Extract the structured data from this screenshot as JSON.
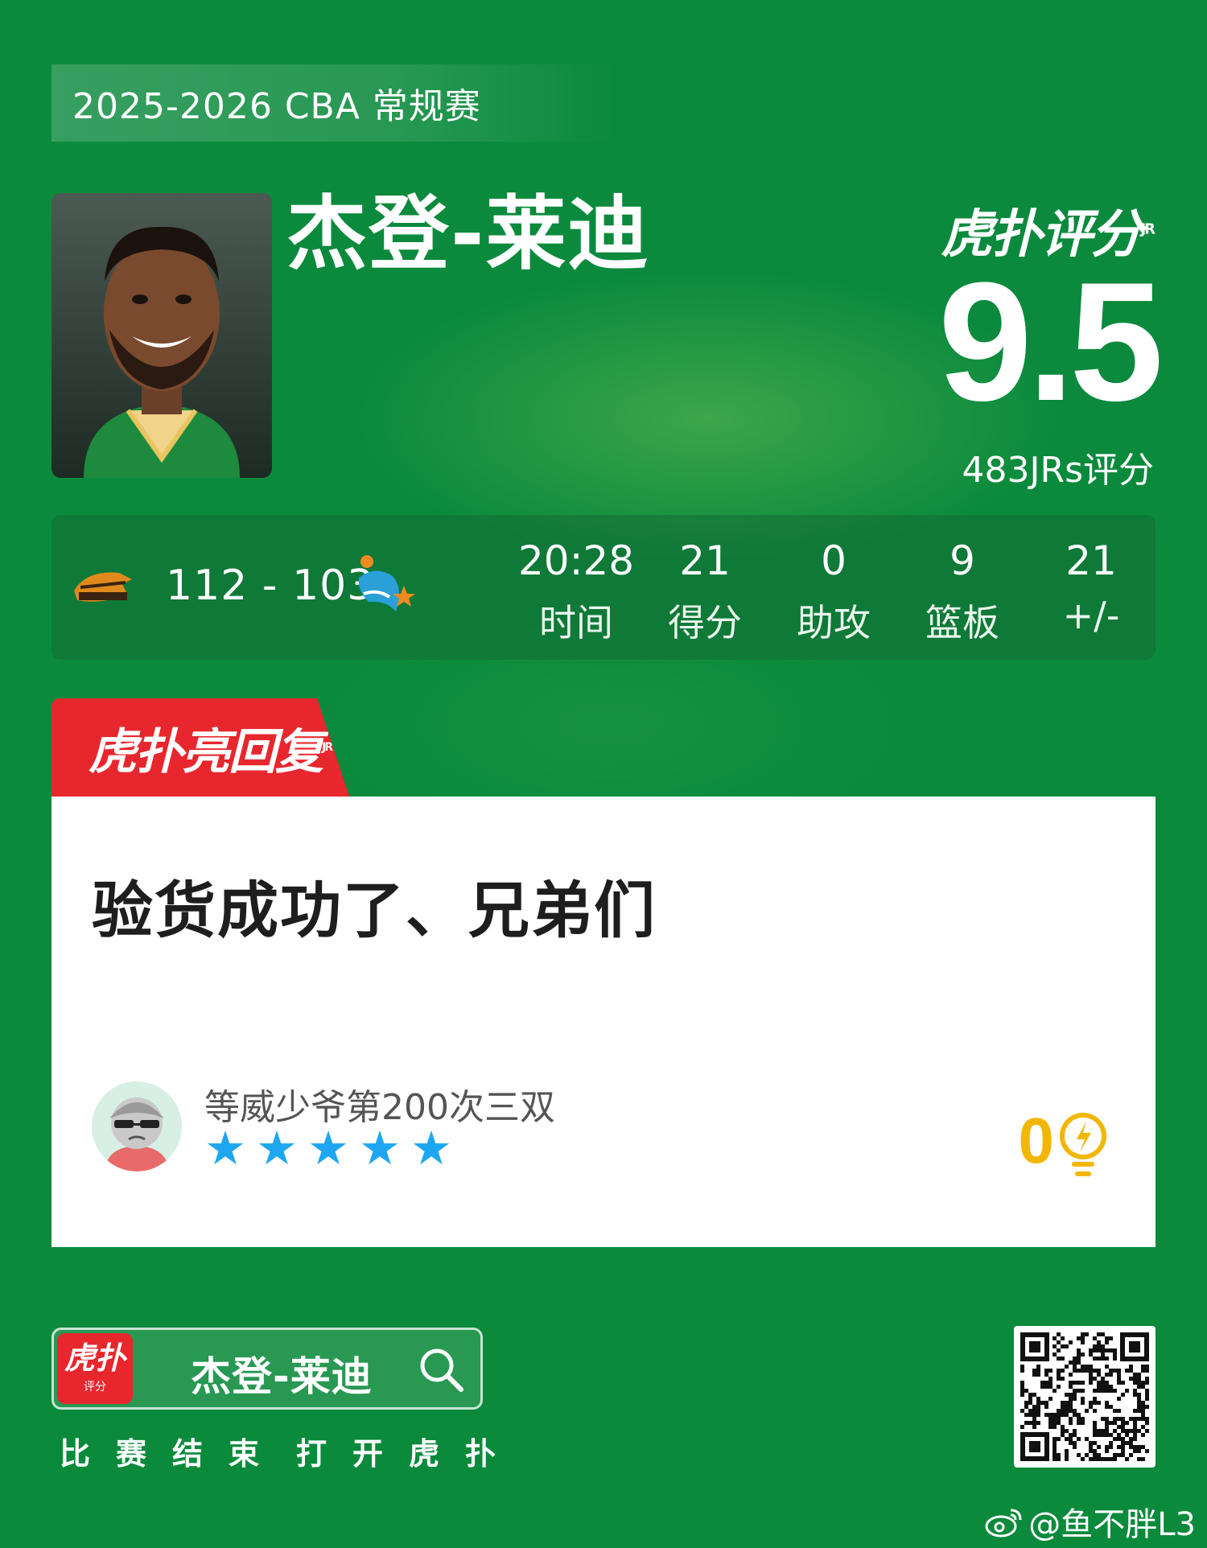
{
  "season": "2025-2026 CBA 常规赛",
  "player": {
    "name": "杰登-莱迪"
  },
  "rating": {
    "logo_main": "虎扑评分",
    "logo_sup": "JR",
    "score": "9.5",
    "count": "483JRs评分"
  },
  "game": {
    "score": "112 - 103",
    "home_team_icon": "leopards-logo-icon",
    "away_team_icon": "dolphin-logo-icon"
  },
  "stats": [
    {
      "value": "20:28",
      "label": "时间"
    },
    {
      "value": "21",
      "label": "得分"
    },
    {
      "value": "0",
      "label": "助攻"
    },
    {
      "value": "9",
      "label": "篮板"
    },
    {
      "value": "21",
      "label": "+/-"
    }
  ],
  "highlight_tab": {
    "label": "虎扑亮回复",
    "sup": "JR"
  },
  "comment": {
    "text": "验货成功了、兄弟们",
    "username": "等威少爷第200次三双",
    "stars": 5,
    "likes": "0"
  },
  "footer": {
    "badge_main": "虎扑",
    "badge_small": "评分",
    "search_name": "杰登-莱迪",
    "cta_left": "比赛结束",
    "cta_right": "打开虎扑"
  },
  "watermark": "@鱼不胖L3",
  "colors": {
    "background": "#0a873c",
    "accent_red": "#e8262d",
    "star_blue": "#1ea7f0",
    "like_yellow": "#f2b705"
  }
}
